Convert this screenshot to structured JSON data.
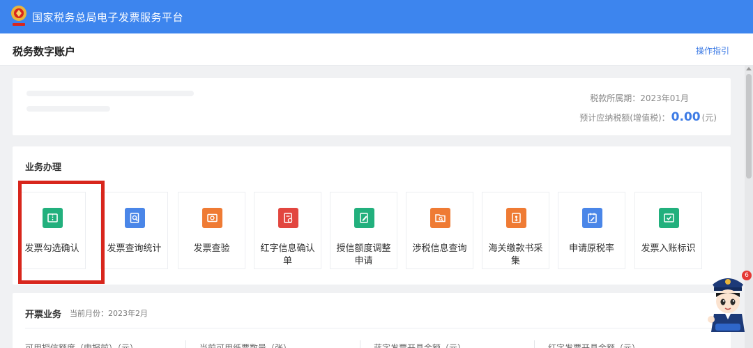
{
  "app": {
    "title": "国家税务总局电子发票服务平台"
  },
  "header": {
    "page_title": "税务数字账户",
    "guide_link": "操作指引"
  },
  "summary": {
    "tax_period": "税款所属期：2023年01月",
    "tax_amount_label": "预计应纳税额(增值税)：",
    "tax_amount_value": "0.00",
    "tax_amount_unit": "(元)"
  },
  "business": {
    "title": "业务办理",
    "tiles": [
      {
        "label": "发票勾选确认",
        "icon": "invoice-check-icon",
        "color": "#22b07d"
      },
      {
        "label": "发票查询统计",
        "icon": "invoice-search-icon",
        "color": "#4a86e8"
      },
      {
        "label": "发票查验",
        "icon": "invoice-verify-icon",
        "color": "#ef7b34"
      },
      {
        "label": "红字信息确认单",
        "icon": "red-letter-icon",
        "color": "#e2463f"
      },
      {
        "label": "授信额度调整申请",
        "icon": "credit-adjust-icon",
        "color": "#22b07d"
      },
      {
        "label": "涉税信息查询",
        "icon": "tax-info-icon",
        "color": "#ef7b34"
      },
      {
        "label": "海关缴款书采集",
        "icon": "customs-collect-icon",
        "color": "#ef7b34"
      },
      {
        "label": "申请原税率",
        "icon": "tax-rate-icon",
        "color": "#4a86e8"
      },
      {
        "label": "发票入账标识",
        "icon": "invoice-booking-icon",
        "color": "#22b07d"
      }
    ]
  },
  "issuing": {
    "title": "开票业务",
    "month": "当前月份：2023年2月",
    "stats": [
      "可用授信额度（申报前）（元）",
      "当前可用纸票数量（张）",
      "蓝字发票开具金额（元）",
      "红字发票开具金额（元）"
    ]
  },
  "assistant": {
    "badge_count": "6"
  }
}
